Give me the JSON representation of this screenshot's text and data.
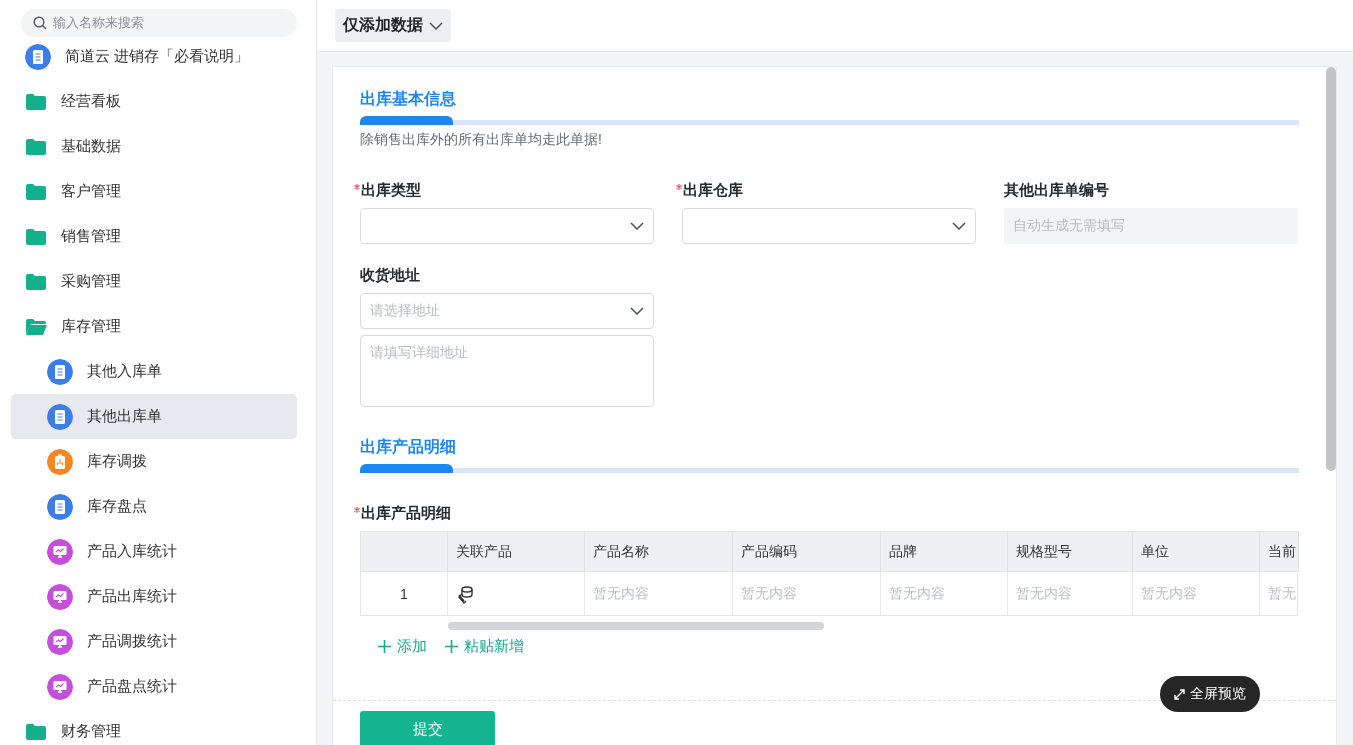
{
  "sidebar": {
    "search": {
      "placeholder": "输入名称来搜索"
    },
    "items": [
      {
        "kind": "doc",
        "label": "简道云 进销存「必看说明」",
        "selected": false
      },
      {
        "kind": "folder",
        "label": "经营看板",
        "expanded": false,
        "selected": false
      },
      {
        "kind": "folder",
        "label": "基础数据",
        "expanded": false,
        "selected": false
      },
      {
        "kind": "folder",
        "label": "客户管理",
        "expanded": false,
        "selected": false
      },
      {
        "kind": "folder",
        "label": "销售管理",
        "expanded": false,
        "selected": false
      },
      {
        "kind": "folder",
        "label": "采购管理",
        "expanded": false,
        "selected": false
      },
      {
        "kind": "folder",
        "label": "库存管理",
        "expanded": true,
        "selected": false,
        "children": [
          {
            "kind": "doc",
            "label": "其他入库单",
            "selected": false
          },
          {
            "kind": "doc",
            "label": "其他出库单",
            "selected": true
          },
          {
            "kind": "transfer",
            "label": "库存调拨",
            "selected": false
          },
          {
            "kind": "doc",
            "label": "库存盘点",
            "selected": false
          },
          {
            "kind": "report",
            "label": "产品入库统计",
            "selected": false
          },
          {
            "kind": "report",
            "label": "产品出库统计",
            "selected": false
          },
          {
            "kind": "report",
            "label": "产品调拨统计",
            "selected": false
          },
          {
            "kind": "report",
            "label": "产品盘点统计",
            "selected": false
          }
        ]
      },
      {
        "kind": "folder",
        "label": "财务管理",
        "expanded": false,
        "selected": false
      }
    ]
  },
  "toolbar": {
    "mode_button": "仅添加数据"
  },
  "form": {
    "sections": [
      {
        "title": "出库基本信息",
        "description": "除销售出库外的所有出库单均走此单据!",
        "fields": [
          {
            "kind": "select",
            "label": "出库类型",
            "required": true
          },
          {
            "kind": "select",
            "label": "出库仓库",
            "required": true
          },
          {
            "kind": "readonly",
            "label": "其他出库单编号",
            "required": false,
            "placeholder": "自动生成无需填写"
          },
          {
            "kind": "address",
            "label": "收货地址",
            "required": false,
            "placeholder": "请选择地址",
            "detail_placeholder": "请填写详细地址"
          }
        ]
      },
      {
        "title": "出库产品明细",
        "table": {
          "label": "出库产品明细",
          "required": true,
          "columns": [
            "",
            "关联产品",
            "产品名称",
            "产品编码",
            "品牌",
            "规格型号",
            "单位",
            "当前"
          ],
          "rows": [
            {
              "cells": [
                "1",
                "",
                "暂无内容",
                "暂无内容",
                "暂无内容",
                "暂无内容",
                "暂无内容",
                "暂无"
              ]
            }
          ],
          "actions": [
            "添加",
            "粘贴新增"
          ]
        }
      }
    ],
    "submit": "提交",
    "fullscreen": "全屏预览"
  }
}
